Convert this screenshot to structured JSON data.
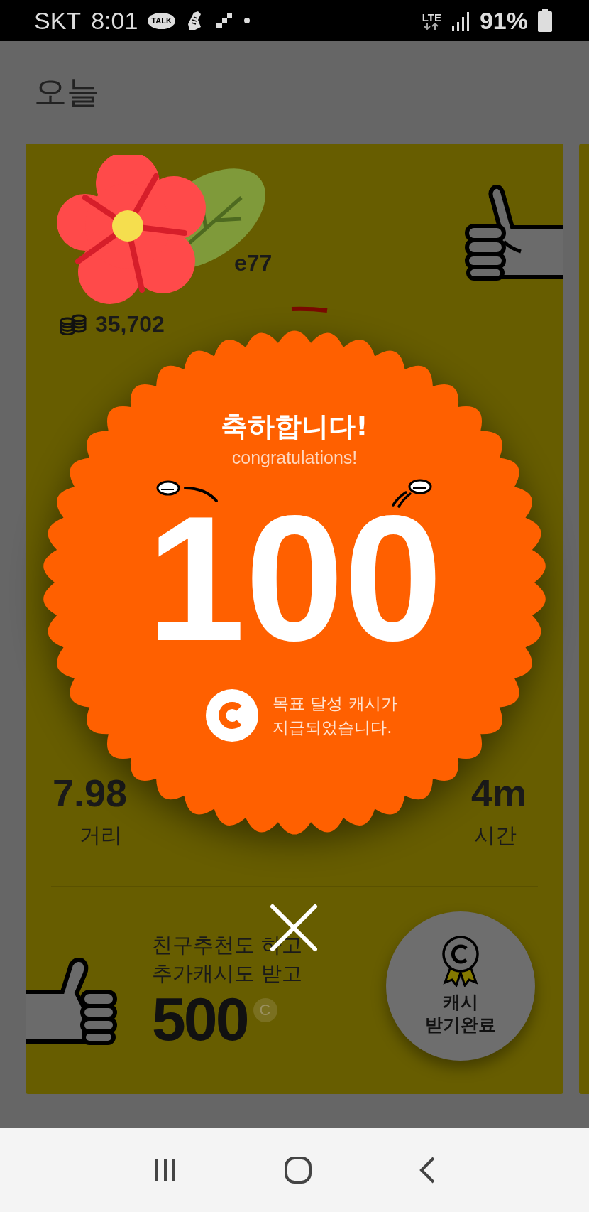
{
  "status_bar": {
    "carrier": "SKT",
    "time": "8:01",
    "talk_badge": "TALK",
    "network": "LTE",
    "battery": "91%"
  },
  "header": {
    "title": "오늘"
  },
  "card": {
    "username_tail": "e77",
    "coins": "35,702",
    "stats": [
      {
        "value": "7.98",
        "label": "거리"
      },
      {
        "value": "4m",
        "label": "시간"
      }
    ],
    "promo": {
      "lines": [
        "친구추천도 하고",
        "추가캐시도 받고"
      ],
      "amount": "500",
      "unit": "C"
    },
    "claim_button": {
      "lines": [
        "캐시",
        "받기완료"
      ]
    }
  },
  "popup": {
    "title": "축하합니다!",
    "subtitle": "congratulations!",
    "amount": "100",
    "message": [
      "목표 달성 캐시가",
      "지급되었습니다."
    ]
  }
}
